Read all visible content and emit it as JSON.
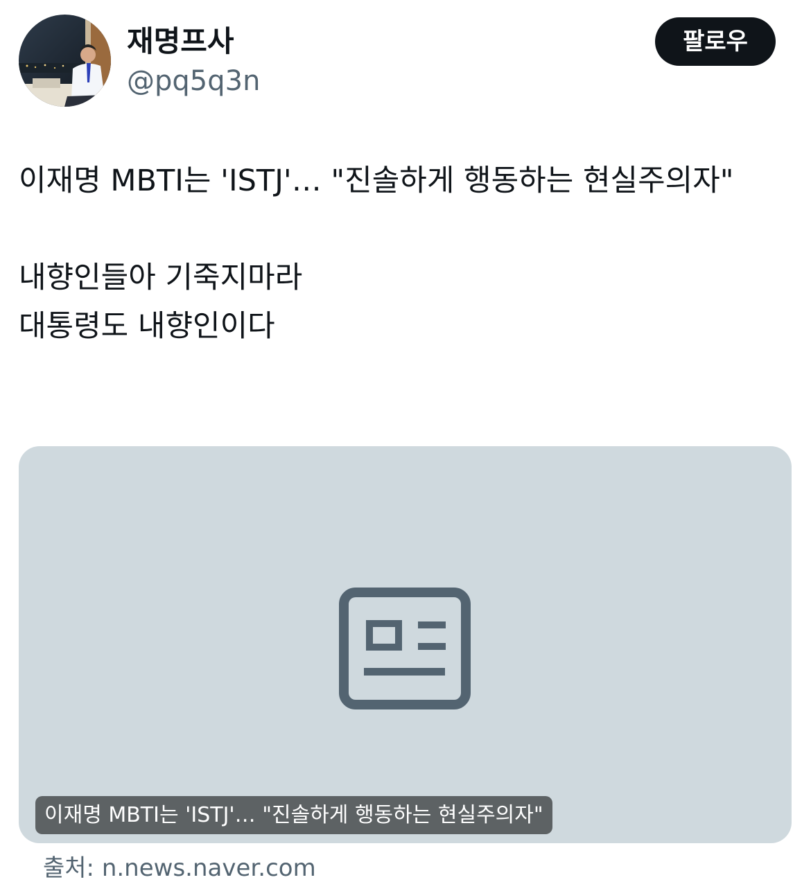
{
  "user": {
    "display_name": "재명프사",
    "handle": "@pq5q3n",
    "follow_label": "팔로우"
  },
  "tweet": {
    "paragraphs": [
      [
        "이재명 MBTI는 'ISTJ'… \"진솔하게 행동하는 현실주의자\""
      ],
      [
        "내향인들아 기죽지마라",
        "대통령도 내향인이다"
      ]
    ]
  },
  "card": {
    "icon": "news-article-icon",
    "caption": "이재명 MBTI는 'ISTJ'… \"진솔하게 행동하는 현실주의자\"",
    "source_prefix": "출처: ",
    "source_domain": "n.news.naver.com"
  },
  "colors": {
    "text_primary": "#0f1419",
    "text_secondary": "#536471",
    "card_bg": "#cfd9de",
    "follow_bg": "#0f1419"
  }
}
